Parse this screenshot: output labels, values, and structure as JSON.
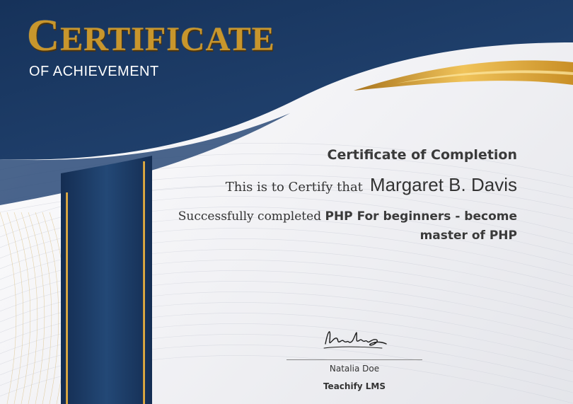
{
  "certificate": {
    "title_first_letter": "C",
    "title_rest": "ERTIFICATE",
    "subtitle": "OF ACHIEVEMENT",
    "heading": "Certificate of Completion",
    "certify_label": "This is to Certify that",
    "recipient_name": "Margaret B. Davis",
    "completed_label": "Successfully completed",
    "course_name": "PHP For beginners - become master of PHP",
    "signer_name": "Natalia Doe",
    "organization": "Teachify LMS"
  },
  "colors": {
    "navy": "#1d3a63",
    "navy_dark": "#0f2444",
    "gold": "#d9a43a",
    "gold_light": "#f3d27a"
  }
}
